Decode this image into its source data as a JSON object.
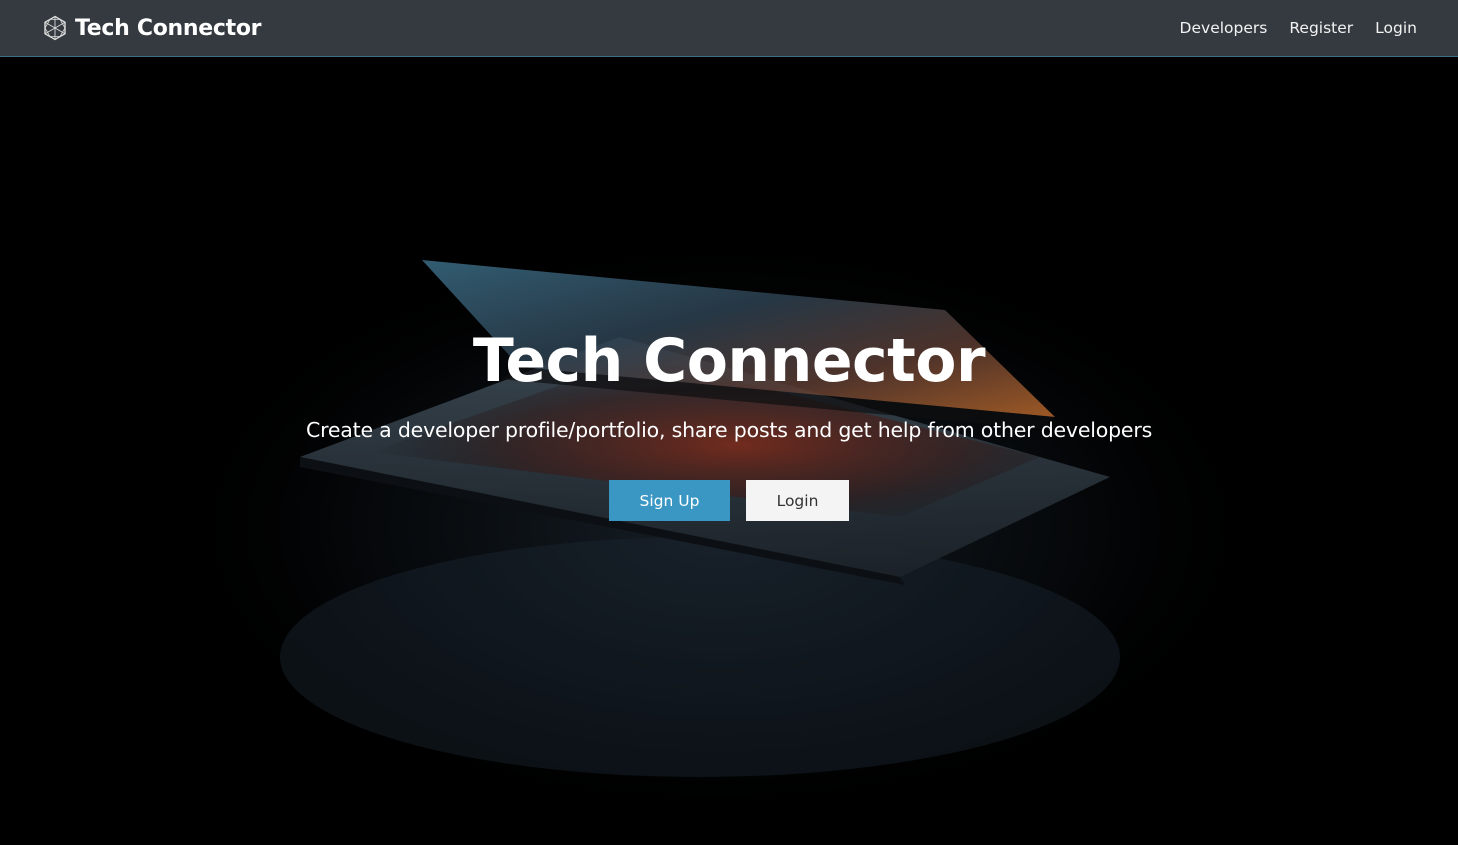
{
  "navbar": {
    "brand": "Tech Connector",
    "brand_icon": "hexagon-network-icon",
    "links": [
      {
        "label": "Developers"
      },
      {
        "label": "Register"
      },
      {
        "label": "Login"
      }
    ],
    "colors": {
      "background": "#343a40",
      "border": "#3f6f86"
    }
  },
  "hero": {
    "title": "Tech Connector",
    "lead": "Create a developer profile/portfolio, share posts and get help from other developers",
    "buttons": {
      "signup_label": "Sign Up",
      "login_label": "Login"
    },
    "colors": {
      "primary": "#3a97c4",
      "light": "#f4f4f4"
    }
  }
}
